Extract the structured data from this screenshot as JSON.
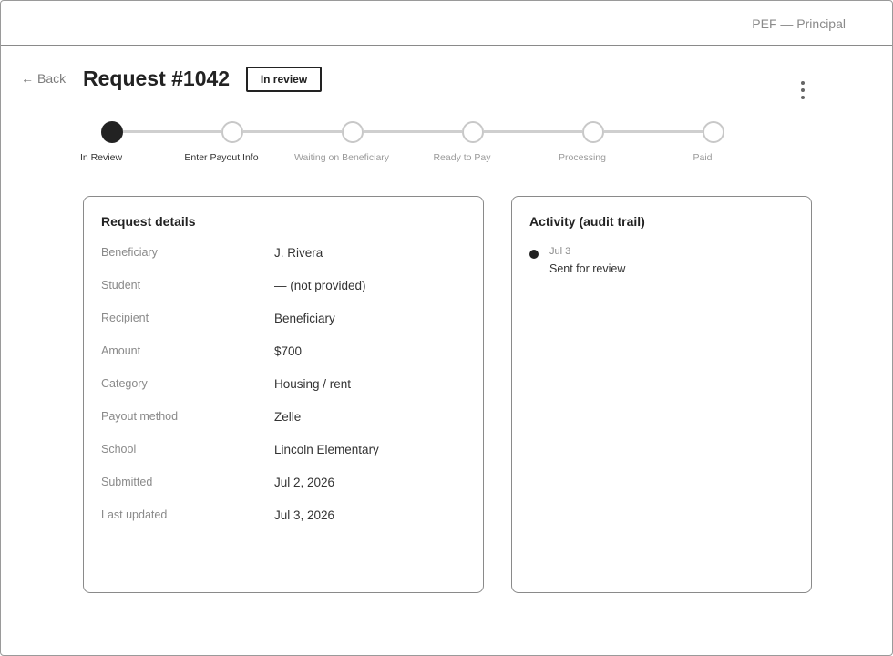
{
  "header": {
    "role_label": "PEF — Principal"
  },
  "page": {
    "back_label": "Back",
    "title": "Request #1042",
    "status": "In review"
  },
  "stepper": {
    "steps": [
      {
        "label": "In Review",
        "state": "current"
      },
      {
        "label": "Enter Payout Info",
        "state": "upcoming"
      },
      {
        "label": "Waiting on Beneficiary",
        "state": "upcoming"
      },
      {
        "label": "Ready to Pay",
        "state": "upcoming"
      },
      {
        "label": "Processing",
        "state": "upcoming"
      },
      {
        "label": "Paid",
        "state": "upcoming"
      }
    ]
  },
  "details": {
    "title": "Request details",
    "rows": [
      {
        "label": "Beneficiary",
        "value": "J. Rivera"
      },
      {
        "label": "Student",
        "value": "— (not provided)"
      },
      {
        "label": "Recipient",
        "value": "Beneficiary"
      },
      {
        "label": "Amount",
        "value": "$700"
      },
      {
        "label": "Category",
        "value": "Housing / rent"
      },
      {
        "label": "Payout method",
        "value": "Zelle"
      },
      {
        "label": "School",
        "value": "Lincoln Elementary"
      },
      {
        "label": "Submitted",
        "value": "Jul 2, 2026"
      },
      {
        "label": "Last updated",
        "value": "Jul 3, 2026"
      }
    ]
  },
  "activity": {
    "title": "Activity (audit trail)",
    "items": [
      {
        "date": "Jul 3",
        "text": "Sent for review"
      }
    ]
  },
  "icons": {
    "back": "arrow-left-icon",
    "more": "more-vertical-icon"
  },
  "colors": {
    "active_step": "#222222",
    "inactive_step": "#c8c8c8"
  }
}
